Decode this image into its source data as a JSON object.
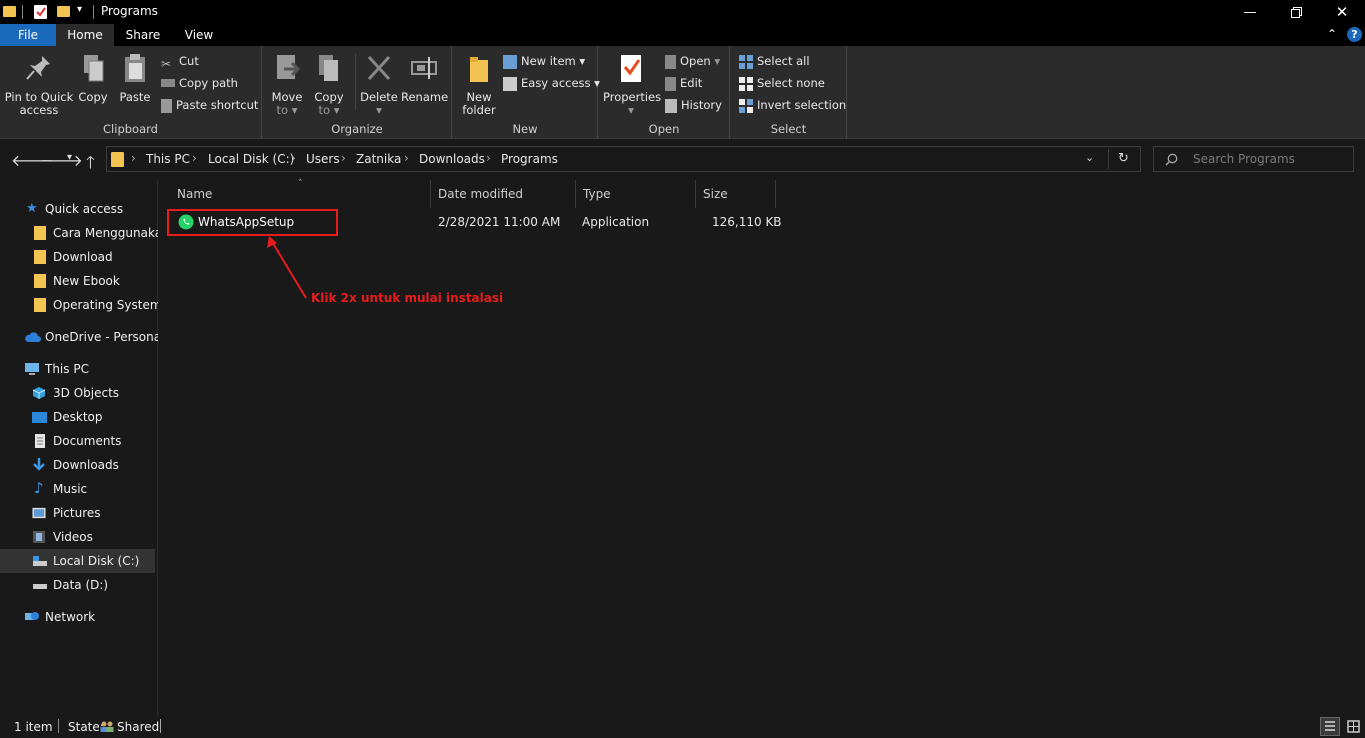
{
  "window": {
    "title": "Programs"
  },
  "tabs": {
    "file": "File",
    "home": "Home",
    "share": "Share",
    "view": "View"
  },
  "ribbon": {
    "clipboard": {
      "label": "Clipboard",
      "pin_line1": "Pin to Quick",
      "pin_line2": "access",
      "copy": "Copy",
      "paste": "Paste",
      "cut": "Cut",
      "copy_path": "Copy path",
      "paste_shortcut": "Paste shortcut"
    },
    "organize": {
      "label": "Organize",
      "move_line1": "Move",
      "move_line2": "to",
      "copy_line1": "Copy",
      "copy_line2": "to",
      "delete": "Delete",
      "rename": "Rename"
    },
    "new": {
      "label": "New",
      "folder_line1": "New",
      "folder_line2": "folder",
      "new_item": "New item",
      "easy_access": "Easy access"
    },
    "open": {
      "label": "Open",
      "properties": "Properties",
      "open": "Open",
      "edit": "Edit",
      "history": "History"
    },
    "select": {
      "label": "Select",
      "select_all": "Select all",
      "select_none": "Select none",
      "invert": "Invert selection"
    }
  },
  "address": {
    "crumbs": [
      "This PC",
      "Local Disk (C:)",
      "Users",
      "Zatnika",
      "Downloads",
      "Programs"
    ],
    "search_placeholder": "Search Programs"
  },
  "sidebar": {
    "quick_access": "Quick access",
    "quick_items": [
      "Cara Menggunakan",
      "Download",
      "New Ebook",
      "Operating System"
    ],
    "onedrive": "OneDrive - Personal",
    "this_pc": "This PC",
    "pc_items": [
      "3D Objects",
      "Desktop",
      "Documents",
      "Downloads",
      "Music",
      "Pictures",
      "Videos",
      "Local Disk (C:)",
      "Data (D:)"
    ],
    "network": "Network"
  },
  "columns": {
    "name": "Name",
    "date": "Date modified",
    "type": "Type",
    "size": "Size"
  },
  "files": [
    {
      "name": "WhatsAppSetup",
      "date": "2/28/2021 11:00 AM",
      "type": "Application",
      "size": "126,110 KB"
    }
  ],
  "annotation": {
    "text": "Klik 2x untuk mulai instalasi",
    "color": "#e81c1c"
  },
  "status": {
    "count": "1 item",
    "state_label": "State:",
    "state_value": "Shared"
  },
  "colors": {
    "accent": "#1a69bd",
    "background": "#191919",
    "ribbon": "#2b2b2b",
    "folder": "#f4c453",
    "whatsapp": "#25d366"
  }
}
